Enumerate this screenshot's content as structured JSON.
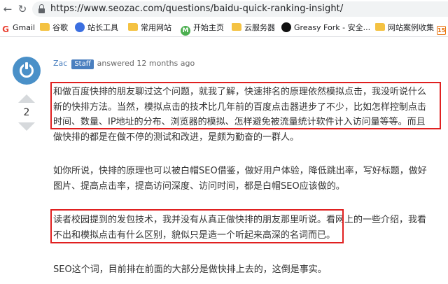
{
  "browser": {
    "url": "https://www.seozac.com/questions/baidu-quick-ranking-insight/"
  },
  "bookmarks": [
    {
      "label": "Gmail",
      "icon": "gmail-icon"
    },
    {
      "label": "谷歌",
      "icon": "folder-icon"
    },
    {
      "label": "站长工具",
      "icon": "baidu-icon"
    },
    {
      "label": "常用网站",
      "icon": "folder-icon"
    },
    {
      "label": "开始主页",
      "icon": "m-icon"
    },
    {
      "label": "云服务器",
      "icon": "folder-icon"
    },
    {
      "label": "Greasy Fork - 安全...",
      "icon": "monkey-icon"
    },
    {
      "label": "网站案例收集",
      "icon": "folder-icon"
    }
  ],
  "answer": {
    "author": "Zac",
    "badge": "Staff",
    "answered_text": "answered 12 months ago",
    "votes": "2",
    "paragraphs": [
      [
        "和做百度快排的朋友聊过这个问题，就我了解，快速排名的原理依然模拟点击，我没听说什么",
        "新的快排方法。当然，模拟点击的技术比几年前的百度点击器进步了不少，比如怎样控制点击",
        "时间、数量、IP地址的分布、浏览器的模拟、怎样避免被流量统计软件计入访问量等等。而且",
        "做快排的都是在做不停的测试和改进，是颇为勤奋的一群人。"
      ],
      [
        "如你所说，快排的原理也可以被白帽SEO借鉴，做好用户体验，降低跳出率，写好标题，做好",
        "图片、提高点击率，提高访问深度、访问时间，都是白帽SEO应该做的。"
      ],
      [
        "读者校园提到的发包技术，我并没有从真正做快排的朋友那里听说。看网上的一些介绍，我看",
        "不出和模拟点击有什么区别，貌似只是造一个听起来高深的名词而已。"
      ],
      [
        "SEO这个词，目前排在前面的大部分是做快排上去的，这倒是事实。"
      ]
    ]
  },
  "colors": {
    "highlight": "#e02020",
    "link": "#4a7fbf",
    "avatar": "#4a90c8"
  }
}
